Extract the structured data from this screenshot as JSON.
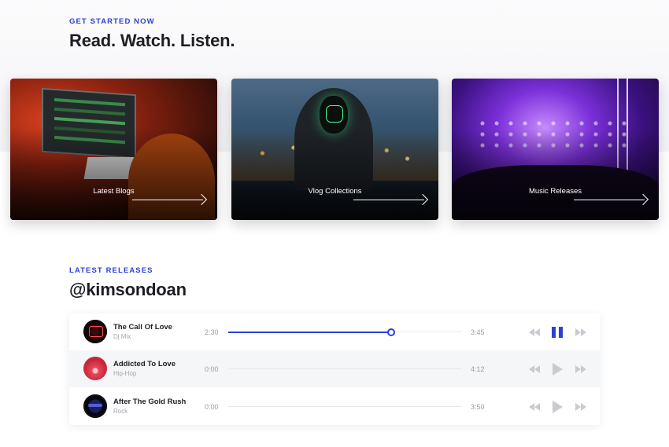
{
  "hero": {
    "eyebrow": "GET STARTED NOW",
    "title": "Read. Watch. Listen."
  },
  "cards": [
    {
      "label": "Latest Blogs"
    },
    {
      "label": "Vlog Collections"
    },
    {
      "label": "Music Releases"
    }
  ],
  "releases": {
    "eyebrow": "LATEST RELEASES",
    "title": "@kimsondoan",
    "tracks": [
      {
        "title": "The Call Of Love",
        "genre": "Dj Mix",
        "current": "2:30",
        "duration": "3:45",
        "progress": 0.7,
        "state": "playing"
      },
      {
        "title": "Addicted To Love",
        "genre": "Hip-Hop",
        "current": "0:00",
        "duration": "4:12",
        "progress": 0,
        "state": "paused"
      },
      {
        "title": "After The Gold Rush",
        "genre": "Rock",
        "current": "0:00",
        "duration": "3:50",
        "progress": 0,
        "state": "paused"
      }
    ]
  },
  "colors": {
    "accent": "#2b3fd6",
    "muted_icon": "#c9cbd1"
  }
}
